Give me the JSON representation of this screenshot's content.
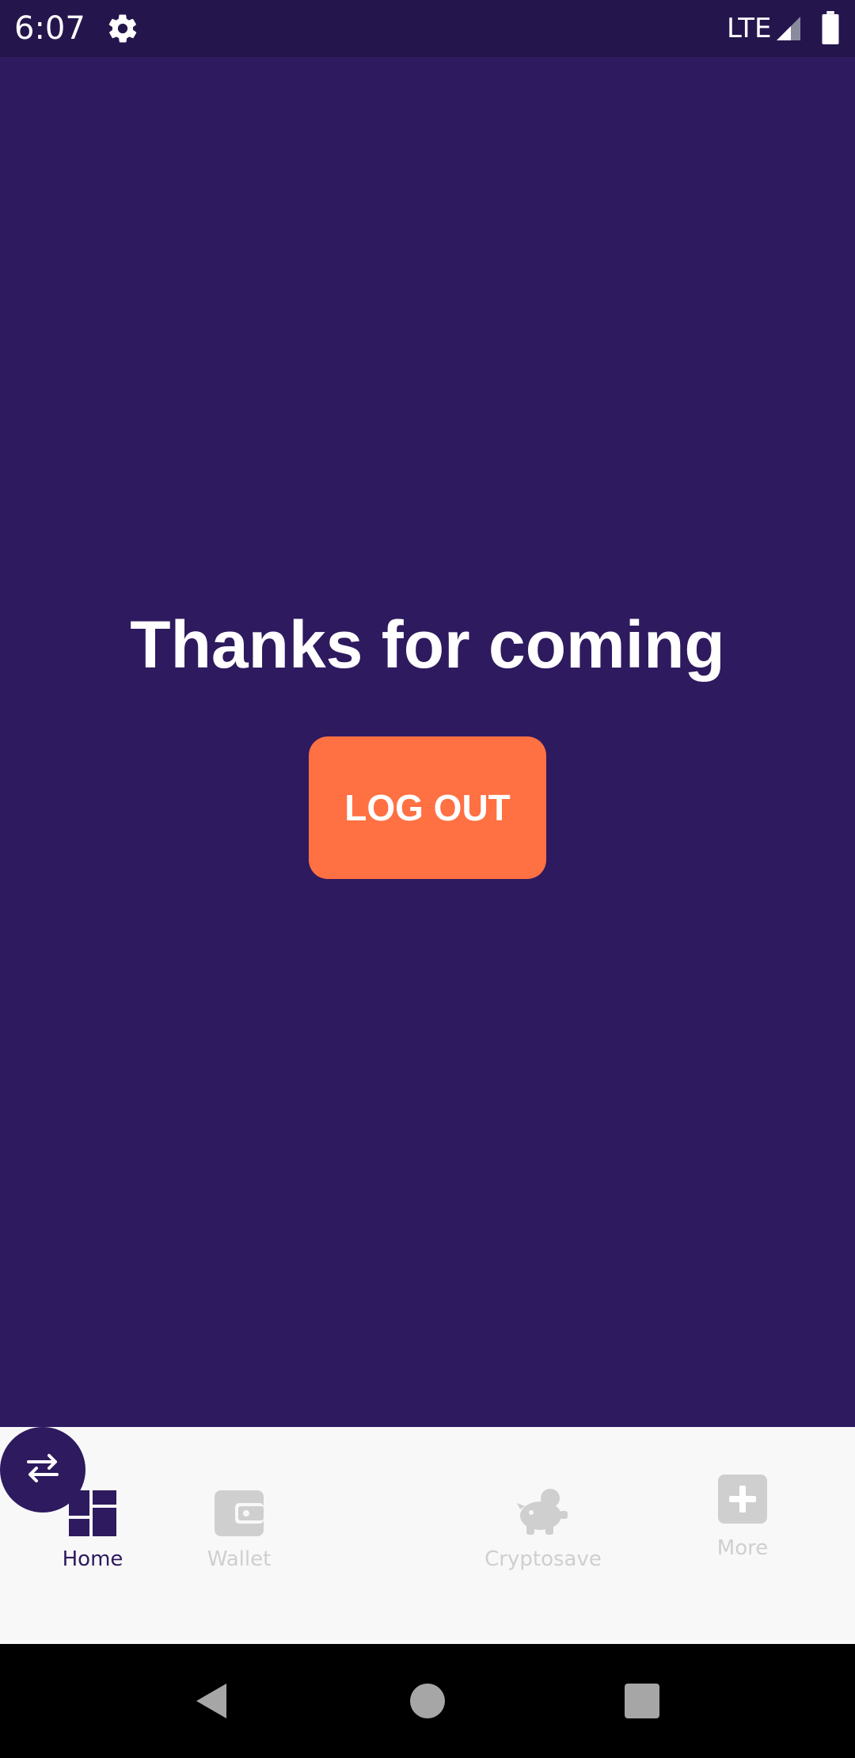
{
  "status_bar": {
    "time": "6:07",
    "network": "LTE",
    "icons": [
      "gear-icon",
      "signal-icon",
      "battery-icon"
    ]
  },
  "main": {
    "title": "Thanks for coming",
    "logout_label": "LOG OUT"
  },
  "bottom_nav": {
    "items": [
      {
        "label": "Home",
        "icon": "dashboard-icon",
        "active": true
      },
      {
        "label": "Wallet",
        "icon": "wallet-icon",
        "active": false
      },
      {
        "label": "",
        "icon": "exchange-icon",
        "active": false
      },
      {
        "label": "Cryptosave",
        "icon": "piggy-bank-icon",
        "active": false
      },
      {
        "label": "More",
        "icon": "plus-icon",
        "active": false
      }
    ]
  },
  "system_nav": {
    "icons": [
      "back-icon",
      "home-circle-icon",
      "recents-icon"
    ]
  },
  "colors": {
    "background": "#2e1a5f",
    "status_bar": "#24164d",
    "accent": "#ff7043",
    "nav_background": "#f8f8f8",
    "nav_inactive": "#cfcfcf",
    "text_on_dark": "#ffffff"
  }
}
